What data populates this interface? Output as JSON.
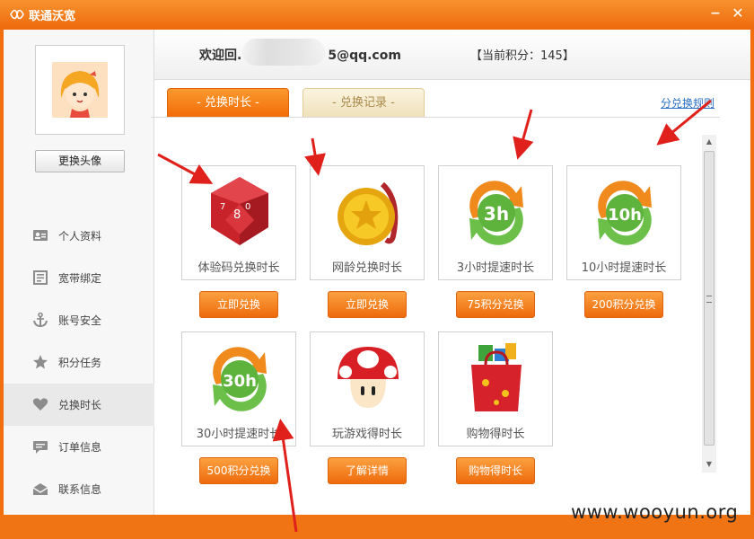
{
  "window": {
    "title": "联通沃宽",
    "minimize_glyph": "−",
    "close_glyph": "✕"
  },
  "sidebar": {
    "change_avatar_label": "更换头像",
    "items": [
      {
        "label": "个人资料",
        "icon": "profile-card-icon"
      },
      {
        "label": "宽带绑定",
        "icon": "document-icon"
      },
      {
        "label": "账号安全",
        "icon": "anchor-icon"
      },
      {
        "label": "积分任务",
        "icon": "star-icon"
      },
      {
        "label": "兑换时长",
        "icon": "heart-icon"
      },
      {
        "label": "订单信息",
        "icon": "message-icon"
      },
      {
        "label": "联系信息",
        "icon": "envelope-icon"
      }
    ],
    "active_index": 4
  },
  "header": {
    "welcome": "欢迎回.",
    "email_suffix": "5@qq.com",
    "points": "【当前积分：145】"
  },
  "tabs": [
    {
      "label": "- 兑换时长 -",
      "active": true
    },
    {
      "label": "- 兑换记录 -",
      "active": false
    }
  ],
  "rules_link": "分兑换规则",
  "cards": [
    {
      "label": "体验码兑换时长",
      "button": "立即兑换",
      "icon": "dice-icon"
    },
    {
      "label": "网龄兑换时长",
      "button": "立即兑换",
      "icon": "gold-medal-icon"
    },
    {
      "label": "3小时提速时长",
      "button": "75积分兑换",
      "icon": "refresh-3h-icon",
      "badge": "3h"
    },
    {
      "label": "10小时提速时长",
      "button": "200积分兑换",
      "icon": "refresh-10h-icon",
      "badge": "10h"
    },
    {
      "label": "30小时提速时长",
      "button": "500积分兑换",
      "icon": "refresh-30h-icon",
      "badge": "30h"
    },
    {
      "label": "玩游戏得时长",
      "button": "了解详情",
      "icon": "mushroom-icon"
    },
    {
      "label": "购物得时长",
      "button": "购物得时长",
      "icon": "gift-bag-icon"
    }
  ],
  "colors": {
    "brand_orange": "#f26f10",
    "accent_green": "#6cc04a",
    "arrow_red": "#e0201b",
    "link_blue": "#2a6fc4"
  },
  "watermark": "www.wooyun.org"
}
